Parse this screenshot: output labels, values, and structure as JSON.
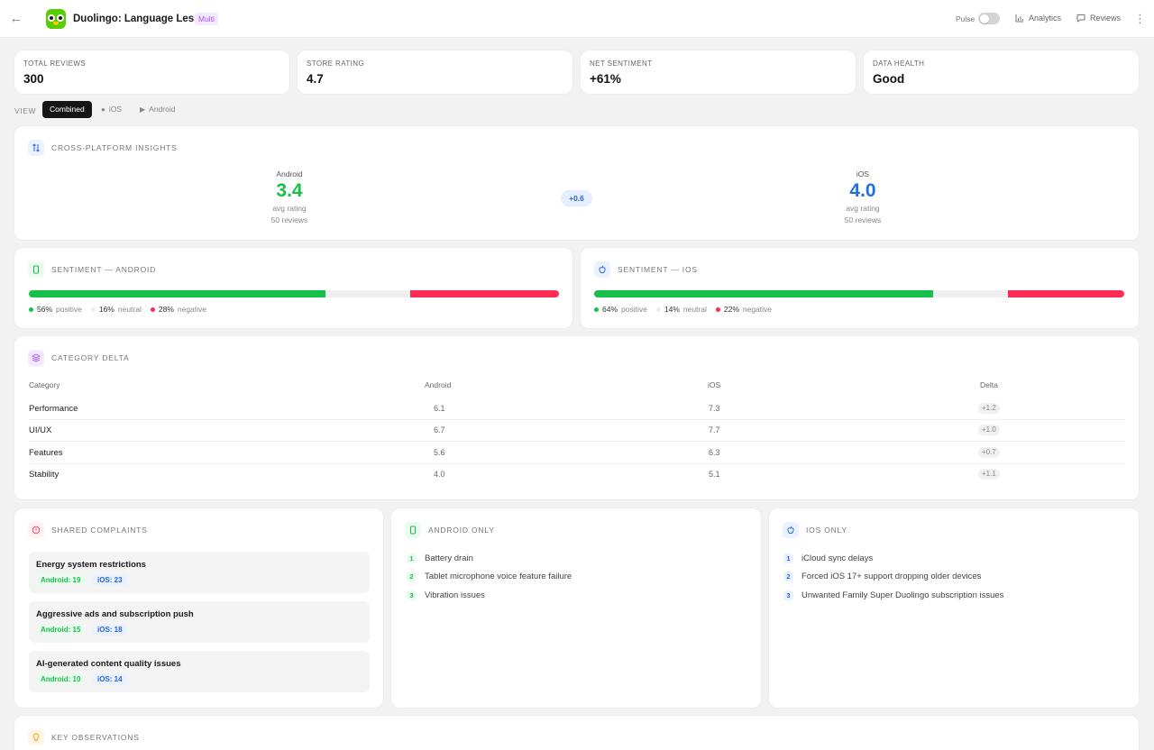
{
  "header": {
    "app_title": "Duolingo: Language Lessons",
    "badge": "Multi",
    "pulse_label": "Pulse",
    "analytics_label": "Analytics",
    "reviews_label": "Reviews"
  },
  "stats": [
    {
      "label": "TOTAL REVIEWS",
      "value": "300"
    },
    {
      "label": "STORE RATING",
      "value": "4.7"
    },
    {
      "label": "NET SENTIMENT",
      "value": "+61%"
    },
    {
      "label": "DATA HEALTH",
      "value": "Good"
    }
  ],
  "view": {
    "label": "VIEW",
    "options": [
      "Combined",
      "iOS",
      "Android"
    ],
    "active": "Combined"
  },
  "cross_platform": {
    "title": "CROSS-PLATFORM INSIGHTS",
    "android": {
      "platform": "Android",
      "rating": "3.4",
      "sub": "avg rating",
      "reviews": "50 reviews"
    },
    "ios": {
      "platform": "iOS",
      "rating": "4.0",
      "sub": "avg rating",
      "reviews": "50 reviews"
    },
    "delta": "+0.6"
  },
  "sentiment_android": {
    "title": "SENTIMENT — ANDROID",
    "positive": 56,
    "neutral": 16,
    "negative": 28,
    "positive_text": "56%",
    "neutral_text": "16%",
    "negative_text": "28%",
    "positive_label": "positive",
    "neutral_label": "neutral",
    "negative_label": "negative"
  },
  "sentiment_ios": {
    "title": "SENTIMENT — IOS",
    "positive": 64,
    "neutral": 14,
    "negative": 22,
    "positive_text": "64%",
    "neutral_text": "14%",
    "negative_text": "22%",
    "positive_label": "positive",
    "neutral_label": "neutral",
    "negative_label": "negative"
  },
  "category_delta": {
    "title": "CATEGORY DELTA",
    "headers": [
      "Category",
      "Android",
      "iOS",
      "Delta"
    ],
    "rows": [
      {
        "category": "Performance",
        "android": "6.1",
        "ios": "7.3",
        "delta": "+1.2"
      },
      {
        "category": "UI/UX",
        "android": "6.7",
        "ios": "7.7",
        "delta": "+1.0"
      },
      {
        "category": "Features",
        "android": "5.6",
        "ios": "6.3",
        "delta": "+0.7"
      },
      {
        "category": "Stability",
        "android": "4.0",
        "ios": "5.1",
        "delta": "+1.1"
      }
    ]
  },
  "shared_complaints": {
    "title": "SHARED COMPLAINTS",
    "items": [
      {
        "title": "Energy system restrictions",
        "android": "Android: 19",
        "ios": "iOS: 23"
      },
      {
        "title": "Aggressive ads and subscription push",
        "android": "Android: 15",
        "ios": "iOS: 18"
      },
      {
        "title": "AI-generated content quality issues",
        "android": "Android: 10",
        "ios": "iOS: 14"
      }
    ]
  },
  "android_only": {
    "title": "ANDROID ONLY",
    "items": [
      "Battery drain",
      "Tablet microphone voice feature failure",
      "Vibration issues"
    ]
  },
  "ios_only": {
    "title": "IOS ONLY",
    "items": [
      "iCloud sync delays",
      "Forced iOS 17+ support dropping older devices",
      "Unwanted Family Super Duolingo subscription issues"
    ]
  },
  "key_observations": {
    "title": "KEY OBSERVATIONS"
  },
  "colors": {
    "green": "#16c04a",
    "blue": "#1f6fe5",
    "red": "#ff2d55",
    "purple": "#a855f7"
  }
}
